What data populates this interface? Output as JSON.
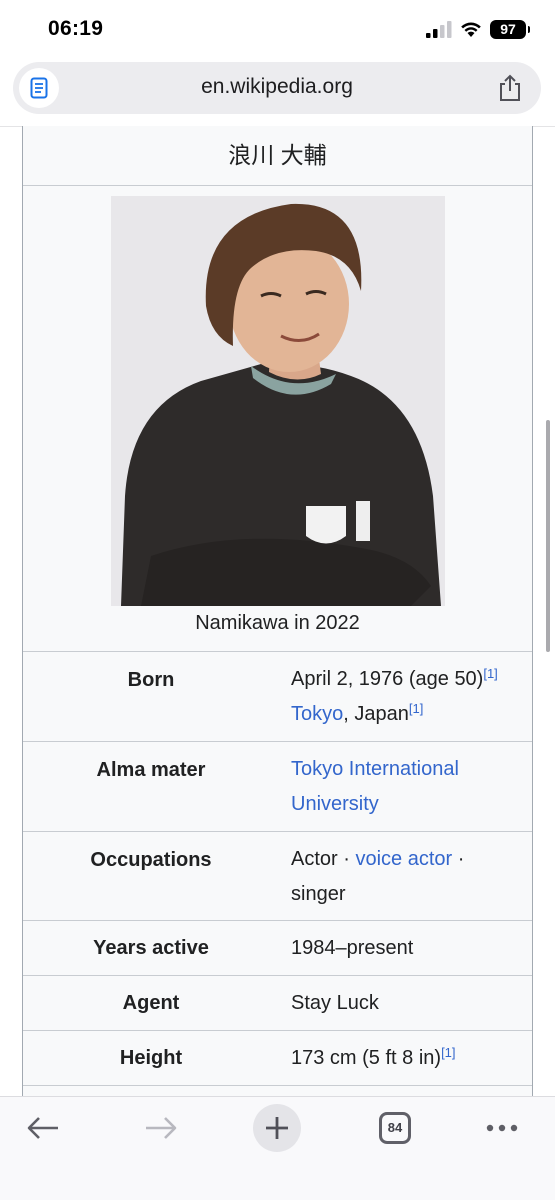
{
  "status_bar": {
    "time": "06:19",
    "battery": "97"
  },
  "browser": {
    "url": "en.wikipedia.org",
    "tab_count": "84",
    "icons": [
      "reader-icon",
      "share-icon",
      "back-icon",
      "forward-icon",
      "new-tab-icon",
      "tabs-icon",
      "more-icon"
    ]
  },
  "infobox": {
    "title": "浪川 大輔",
    "caption": "Namikawa in 2022",
    "born": {
      "label": "Born",
      "date": "April 2, 1976 (age 50)",
      "ref1": "[1]",
      "place_link": "Tokyo",
      "place_rest": ", Japan",
      "ref2": "[1]"
    },
    "alma_mater": {
      "label": "Alma mater",
      "value_line1": "Tokyo International",
      "value_line2": "University"
    },
    "occupations": {
      "label": "Occupations",
      "item1": "Actor",
      "sep": " · ",
      "item2_link": "voice actor",
      "item3": "singer"
    },
    "years_active": {
      "label": "Years active",
      "value": "1984–present"
    },
    "agent": {
      "label": "Agent",
      "value": "Stay Luck"
    },
    "height": {
      "label": "Height",
      "value": "173 cm (5 ft 8 in)",
      "ref": "[1]"
    }
  },
  "colors": {
    "link": "#3366cc",
    "infobox_bg": "#f8f9fa",
    "border": "#c8ccd1"
  }
}
